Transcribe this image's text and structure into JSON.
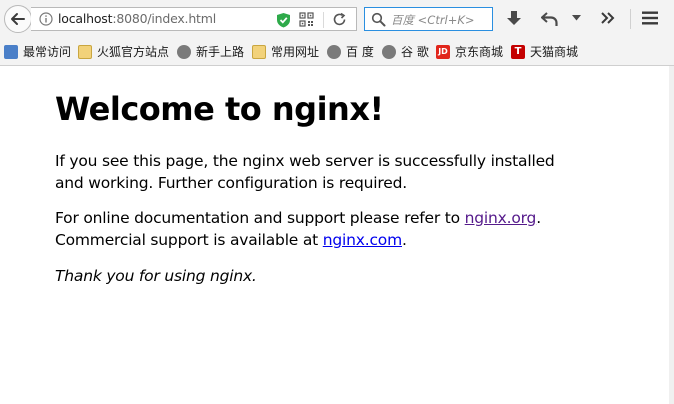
{
  "browser": {
    "url_host": "localhost",
    "url_path": ":8080/index.html",
    "search_placeholder": "百度 <Ctrl+K>"
  },
  "bookmarks": [
    {
      "label": "最常访问",
      "icon": "most-visited-icon"
    },
    {
      "label": "火狐官方站点",
      "icon": "folder-icon"
    },
    {
      "label": "新手上路",
      "icon": "globe-icon"
    },
    {
      "label": "常用网址",
      "icon": "folder-icon"
    },
    {
      "label": "百 度",
      "icon": "globe-icon"
    },
    {
      "label": "谷 歌",
      "icon": "globe-icon"
    },
    {
      "label": "京东商城",
      "icon": "jd-icon",
      "icon_text": "JD"
    },
    {
      "label": "天猫商城",
      "icon": "tmall-icon",
      "icon_text": "T"
    }
  ],
  "page": {
    "heading": "Welcome to nginx!",
    "para1": "If you see this page, the nginx web server is successfully installed and working. Further configuration is required.",
    "para2_a": "For online documentation and support please refer to ",
    "link1": "nginx.org",
    "para2_b": ".",
    "para2_c": "Commercial support is available at ",
    "link2": "nginx.com",
    "para2_d": ".",
    "para3": "Thank you for using nginx."
  },
  "colors": {
    "visited_link": "#551a8b",
    "link": "#0000ee",
    "search_focus_border": "#2a8fe0",
    "shield_green": "#2eaa4a"
  }
}
